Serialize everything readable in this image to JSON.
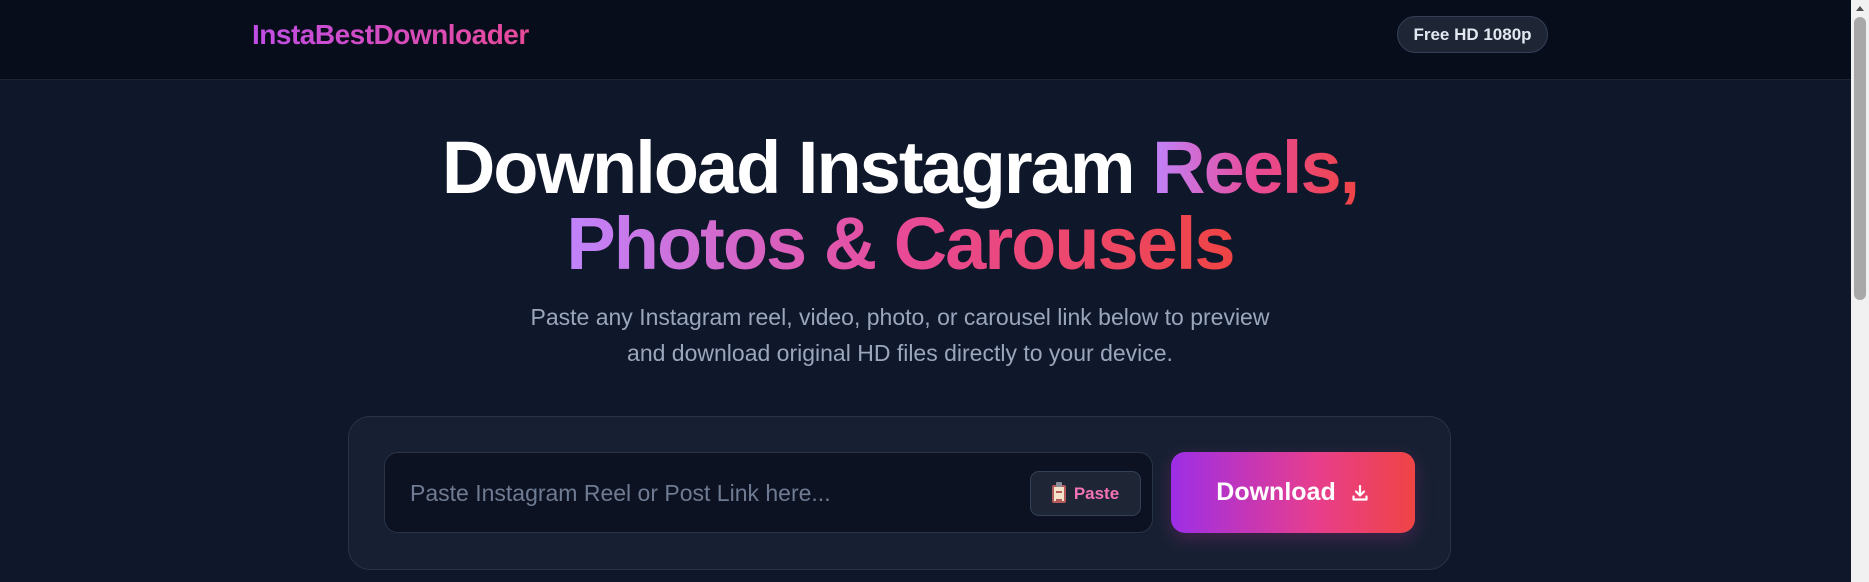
{
  "header": {
    "brand": "InstaBestDownloader",
    "badge": "Free HD 1080p"
  },
  "hero": {
    "title_plain": "Download Instagram ",
    "title_grad_1": "Reels,",
    "title_grad_2": "Photos & Carousels",
    "subtitle_line1": "Paste any Instagram reel, video, photo, or carousel link below to preview",
    "subtitle_line2": "and download original HD files directly to your device."
  },
  "form": {
    "input_placeholder": "Paste Instagram Reel or Post Link here...",
    "input_value": "",
    "paste_label": "Paste",
    "download_label": "Download"
  },
  "icons": {
    "paste": "clipboard-icon",
    "download": "download-icon"
  },
  "colors": {
    "background": "#0f172a",
    "header": "#080d1c",
    "accent_start": "#9d2ee6",
    "accent_mid": "#e83e8c",
    "accent_end": "#ef4444"
  }
}
